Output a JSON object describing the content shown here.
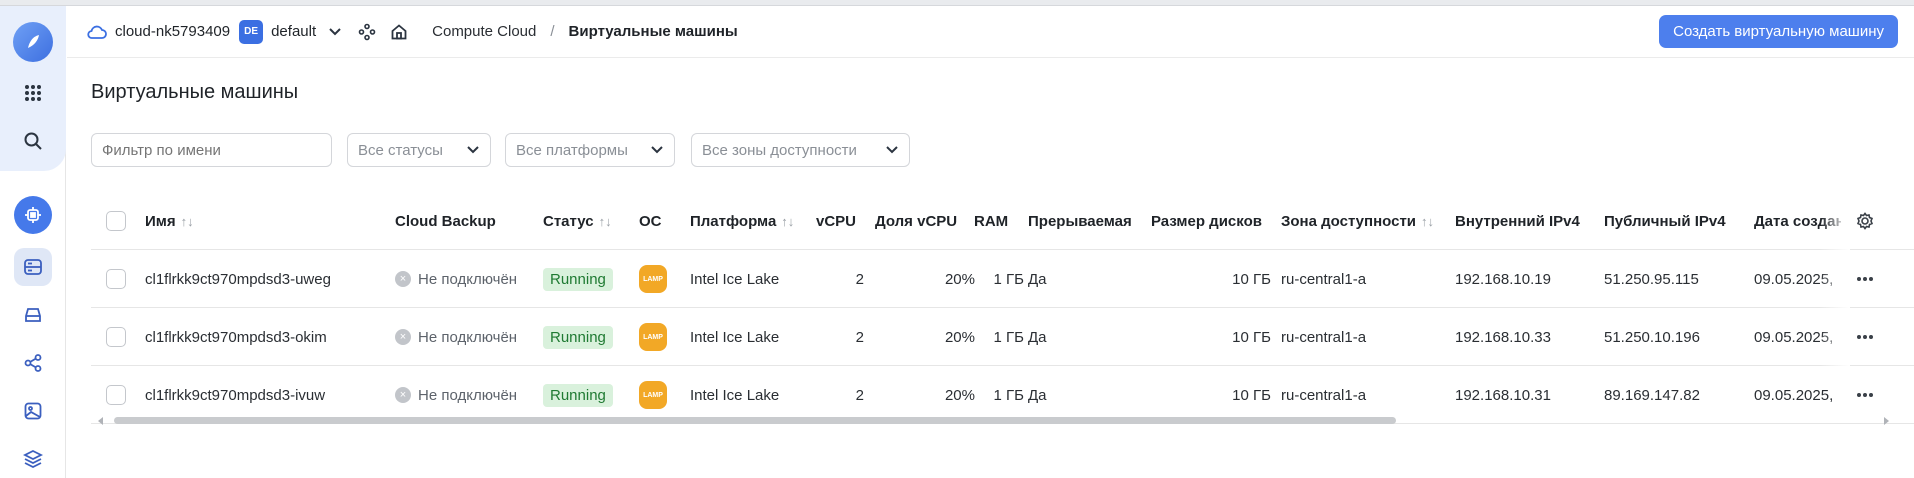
{
  "header": {
    "cloud": "cloud-nk5793409",
    "folder_badge": "DE",
    "folder": "default",
    "breadcrumb_service": "Compute Cloud",
    "breadcrumb_sep": "/",
    "breadcrumb_page": "Виртуальные машины",
    "create_button": "Создать виртуальную машину"
  },
  "page": {
    "title": "Виртуальные машины"
  },
  "filters": {
    "name_placeholder": "Фильтр по имени",
    "status": "Все статусы",
    "platform": "Все платформы",
    "zone": "Все зоны доступности"
  },
  "table": {
    "columns": {
      "name": "Имя",
      "backup": "Cloud Backup",
      "status": "Статус",
      "os": "ОС",
      "platform": "Платформа",
      "vcpu": "vCPU",
      "vcpu_share": "Доля vCPU",
      "ram": "RAM",
      "preemptible": "Прерываемая",
      "disk": "Размер дисков",
      "zone": "Зона доступности",
      "ip_int": "Внутренний IPv4",
      "ip_pub": "Публичный IPv4",
      "date": "Дата создан"
    },
    "sort_glyph": "↑↓",
    "rows": [
      {
        "name": "cl1flrkk9ct970mpdsd3-uweg",
        "backup": "Не подключён",
        "status": "Running",
        "os": "LAMP",
        "platform": "Intel Ice Lake",
        "vcpu": "2",
        "vcpu_share": "20%",
        "ram": "1 ГБ",
        "preemptible": "Да",
        "disk": "10 ГБ",
        "zone": "ru-central1-a",
        "ip_int": "192.168.10.19",
        "ip_pub": "51.250.95.115",
        "date": "09.05.2025,"
      },
      {
        "name": "cl1flrkk9ct970mpdsd3-okim",
        "backup": "Не подключён",
        "status": "Running",
        "os": "LAMP",
        "platform": "Intel Ice Lake",
        "vcpu": "2",
        "vcpu_share": "20%",
        "ram": "1 ГБ",
        "preemptible": "Да",
        "disk": "10 ГБ",
        "zone": "ru-central1-a",
        "ip_int": "192.168.10.33",
        "ip_pub": "51.250.10.196",
        "date": "09.05.2025,"
      },
      {
        "name": "cl1flrkk9ct970mpdsd3-ivuw",
        "backup": "Не подключён",
        "status": "Running",
        "os": "LAMP",
        "platform": "Intel Ice Lake",
        "vcpu": "2",
        "vcpu_share": "20%",
        "ram": "1 ГБ",
        "preemptible": "Да",
        "disk": "10 ГБ",
        "zone": "ru-central1-a",
        "ip_int": "192.168.10.31",
        "ip_pub": "89.169.147.82",
        "date": "09.05.2025,"
      }
    ]
  },
  "colors": {
    "accent": "#4d7fed",
    "running_bg": "#d9f1dc",
    "running_fg": "#1f7a32",
    "lamp": "#f2a826"
  }
}
